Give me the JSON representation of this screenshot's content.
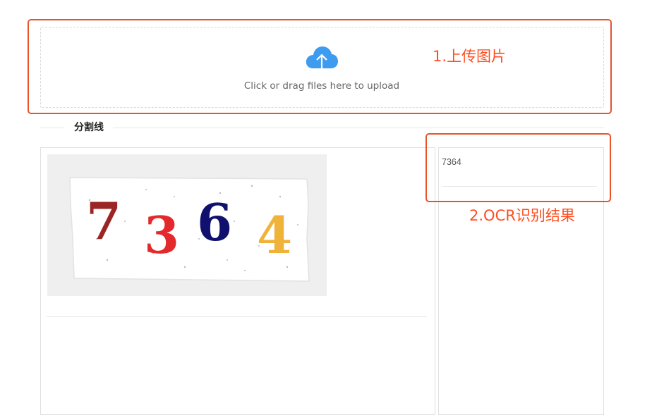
{
  "upload": {
    "hint": "Click or drag files here to upload",
    "icon": "cloud-upload-icon",
    "icon_color": "#3d9bf0"
  },
  "annotations": {
    "step1": "1.上传图片",
    "step2": "2.OCR识别结果",
    "color": "#e8532a"
  },
  "divider": {
    "label": "分割线"
  },
  "image_card": {
    "captcha_digits": [
      "7",
      "3",
      "6",
      "4"
    ],
    "digit_colors": [
      "#9b2525",
      "#e3292b",
      "#10106e",
      "#f0b33a"
    ]
  },
  "result_card": {
    "ocr_text": "7364"
  }
}
